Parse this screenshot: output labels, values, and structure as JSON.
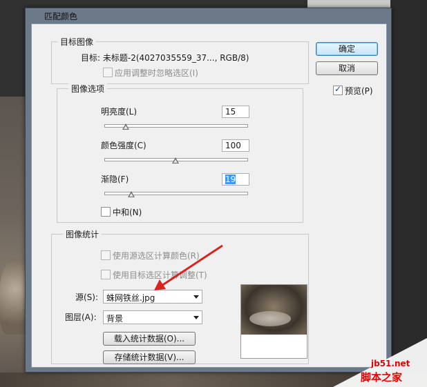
{
  "dialog": {
    "title": "匹配颜色",
    "ok_label": "确定",
    "cancel_label": "取消",
    "preview_label": "预览(P)",
    "preview_checked": true
  },
  "target_image": {
    "group_label": "目标图像",
    "target_label": "目标: 未标题-2(4027035559_37..., RGB/8)",
    "ignore_selection_label": "应用调整时忽略选区(I)"
  },
  "image_options": {
    "group_label": "图像选项",
    "luminance_label": "明亮度(L)",
    "luminance_value": "15",
    "luminance_level": 0.15,
    "color_intensity_label": "颜色强度(C)",
    "color_intensity_value": "100",
    "color_intensity_level": 0.5,
    "fade_label": "渐隐(F)",
    "fade_value": "19",
    "fade_level": 0.19,
    "neutralize_label": "中和(N)"
  },
  "image_statistics": {
    "group_label": "图像统计",
    "use_source_selection_label": "使用源选区计算颜色(R)",
    "use_target_selection_label": "使用目标选区计算调整(T)",
    "source_label": "源(S):",
    "source_value": "蛛网铁丝.jpg",
    "layer_label": "图层(A):",
    "layer_value": "背景",
    "load_stats_label": "载入统计数据(O)...",
    "save_stats_label": "存储统计数据(V)..."
  },
  "watermark": {
    "site": "jb51.net",
    "name": "脚本之家"
  },
  "colors": {
    "annotation_arrow": "#d9231e",
    "selection": "#3399ff",
    "watermark": "#e60000"
  }
}
